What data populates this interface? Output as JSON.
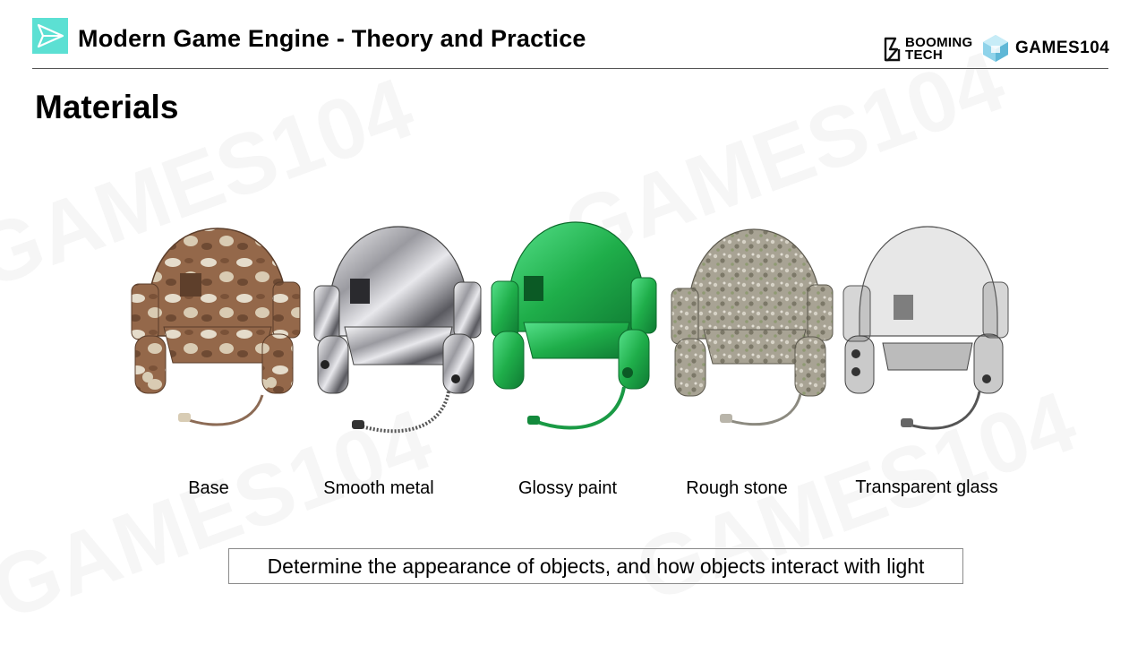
{
  "header": {
    "course_title": "Modern Game Engine - Theory and Practice",
    "brand_booming": [
      "BOOMING",
      "TECH"
    ],
    "brand_games": "GAMES104",
    "accent_color": "#5ce0d3"
  },
  "page_title": "Materials",
  "materials": [
    {
      "label": "Base",
      "icon": "camouflage-helmet",
      "color": "#9a6e4e"
    },
    {
      "label": "Smooth metal",
      "icon": "chrome-helmet",
      "color": "#b8b8bc"
    },
    {
      "label": "Glossy paint",
      "icon": "green-helmet",
      "color": "#1fae4a"
    },
    {
      "label": "Rough stone",
      "icon": "stone-helmet",
      "color": "#a8a394"
    },
    {
      "label": "Transparent glass",
      "icon": "glass-helmet",
      "color": "#7a7a7a"
    }
  ],
  "note": "Determine the appearance of objects, and how objects interact with light"
}
